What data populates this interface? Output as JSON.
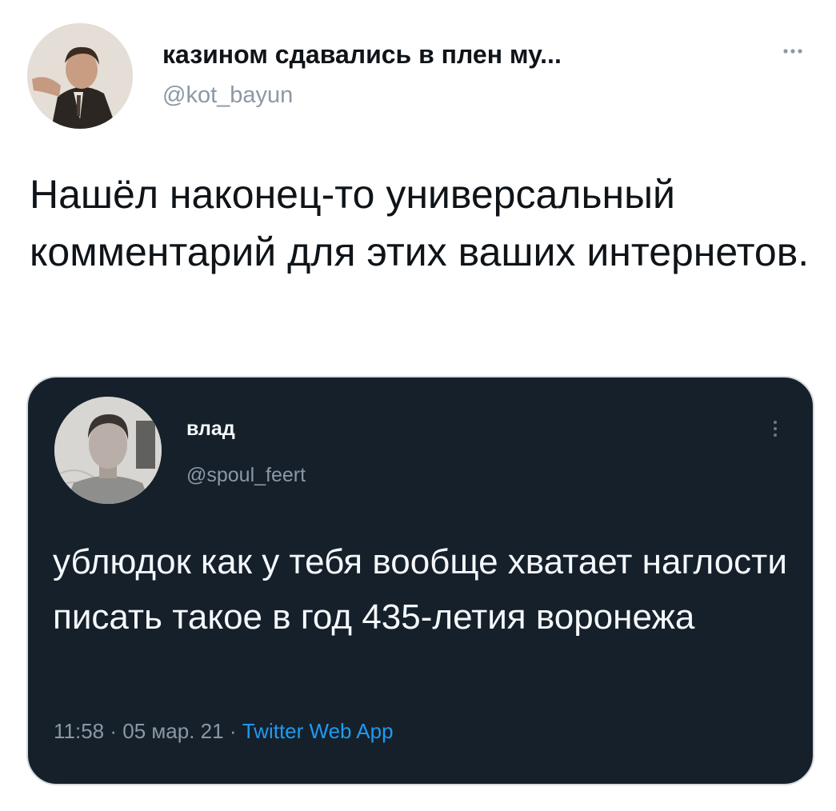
{
  "tweet": {
    "author": {
      "display_name": "казином сдавались в плен му...",
      "handle": "@kot_bayun",
      "avatar_icon": "user-avatar-photo"
    },
    "more_icon": "more-horizontal-icon",
    "text": "Нашёл наконец-то универсальный комментарий для этих ваших интернетов."
  },
  "quoted": {
    "author": {
      "display_name": "влад",
      "handle": "@spoul_feert",
      "avatar_icon": "user-avatar-photo"
    },
    "more_icon": "more-vertical-icon",
    "text": "ублюдок как у тебя вообще хватает наглости писать такое в год 435-летия воронежа",
    "time": "11:58",
    "separator": "·",
    "date": "05 мар. 21",
    "source": "Twitter Web App"
  },
  "colors": {
    "text_primary": "#0f1419",
    "text_secondary": "#8b98a5",
    "card_background": "#15202b",
    "link": "#1d9bf0"
  }
}
